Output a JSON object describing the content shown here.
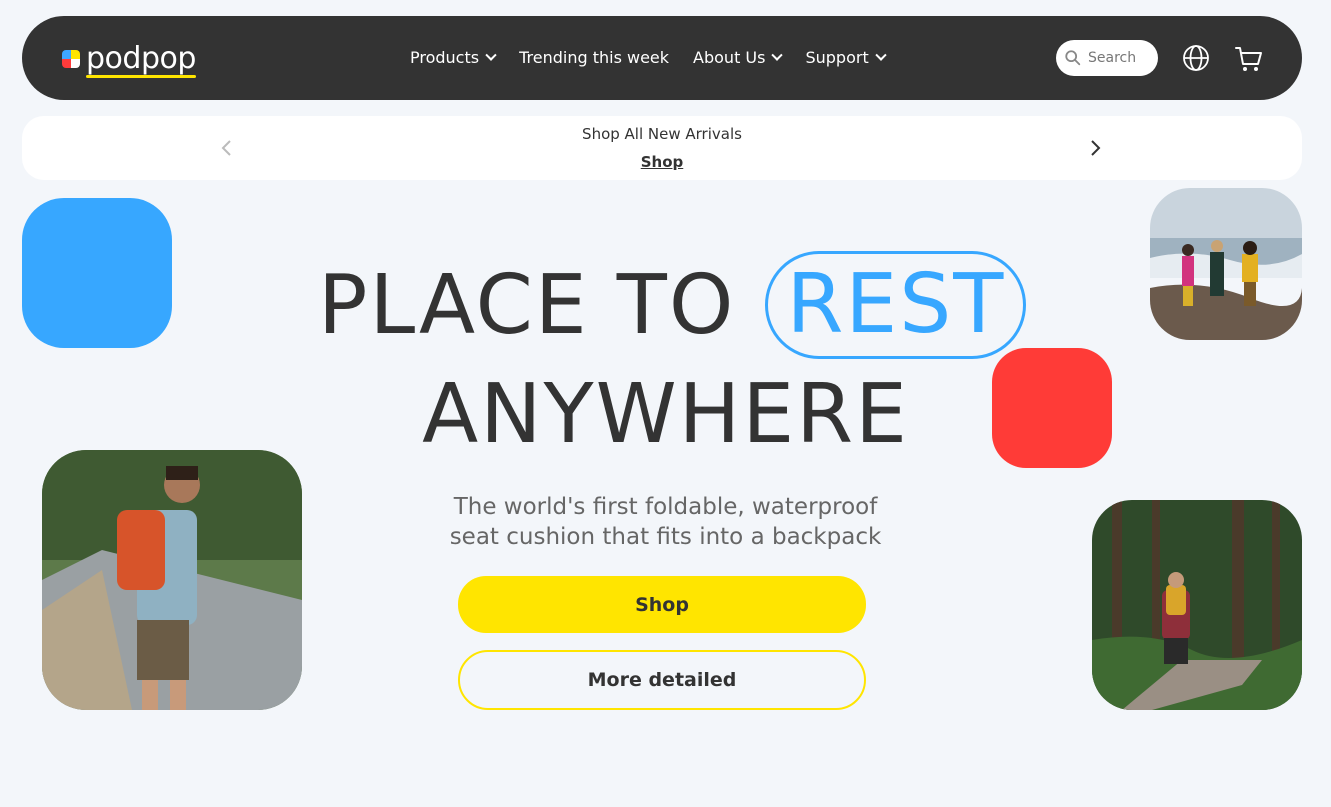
{
  "brand": {
    "name": "podpop",
    "colors": {
      "blue": "#37a7ff",
      "yellow": "#ffe500",
      "red": "#ff3b37",
      "dark": "#333333"
    }
  },
  "nav": {
    "items": [
      {
        "label": "Products",
        "has_dropdown": true
      },
      {
        "label": "Trending this week",
        "has_dropdown": false
      },
      {
        "label": "About Us",
        "has_dropdown": true
      },
      {
        "label": "Support",
        "has_dropdown": true
      }
    ],
    "search_placeholder": "Search",
    "icons": [
      "search-icon",
      "globe-icon",
      "cart-icon"
    ]
  },
  "announcement": {
    "text": "Shop All New Arrivals",
    "link": "Shop"
  },
  "hero": {
    "title_part1": "PLACE TO",
    "title_highlight": "REST",
    "title_part2": "ANYWHERE",
    "subtitle_line1": "The world's first foldable, waterproof",
    "subtitle_line2": "seat cushion that fits into a backpack",
    "primary_button": "Shop",
    "secondary_button": "More detailed"
  }
}
